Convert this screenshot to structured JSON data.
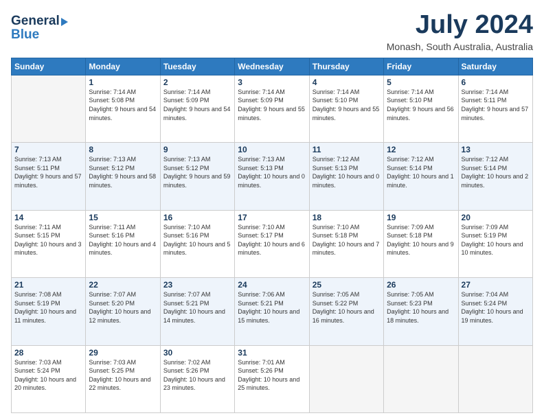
{
  "logo": {
    "line1": "General",
    "line2": "Blue"
  },
  "header": {
    "month": "July 2024",
    "location": "Monash, South Australia, Australia"
  },
  "weekdays": [
    "Sunday",
    "Monday",
    "Tuesday",
    "Wednesday",
    "Thursday",
    "Friday",
    "Saturday"
  ],
  "weeks": [
    [
      {
        "day": "",
        "sunrise": "",
        "sunset": "",
        "daylight": ""
      },
      {
        "day": "1",
        "sunrise": "Sunrise: 7:14 AM",
        "sunset": "Sunset: 5:08 PM",
        "daylight": "Daylight: 9 hours and 54 minutes."
      },
      {
        "day": "2",
        "sunrise": "Sunrise: 7:14 AM",
        "sunset": "Sunset: 5:09 PM",
        "daylight": "Daylight: 9 hours and 54 minutes."
      },
      {
        "day": "3",
        "sunrise": "Sunrise: 7:14 AM",
        "sunset": "Sunset: 5:09 PM",
        "daylight": "Daylight: 9 hours and 55 minutes."
      },
      {
        "day": "4",
        "sunrise": "Sunrise: 7:14 AM",
        "sunset": "Sunset: 5:10 PM",
        "daylight": "Daylight: 9 hours and 55 minutes."
      },
      {
        "day": "5",
        "sunrise": "Sunrise: 7:14 AM",
        "sunset": "Sunset: 5:10 PM",
        "daylight": "Daylight: 9 hours and 56 minutes."
      },
      {
        "day": "6",
        "sunrise": "Sunrise: 7:14 AM",
        "sunset": "Sunset: 5:11 PM",
        "daylight": "Daylight: 9 hours and 57 minutes."
      }
    ],
    [
      {
        "day": "7",
        "sunrise": "Sunrise: 7:13 AM",
        "sunset": "Sunset: 5:11 PM",
        "daylight": "Daylight: 9 hours and 57 minutes."
      },
      {
        "day": "8",
        "sunrise": "Sunrise: 7:13 AM",
        "sunset": "Sunset: 5:12 PM",
        "daylight": "Daylight: 9 hours and 58 minutes."
      },
      {
        "day": "9",
        "sunrise": "Sunrise: 7:13 AM",
        "sunset": "Sunset: 5:12 PM",
        "daylight": "Daylight: 9 hours and 59 minutes."
      },
      {
        "day": "10",
        "sunrise": "Sunrise: 7:13 AM",
        "sunset": "Sunset: 5:13 PM",
        "daylight": "Daylight: 10 hours and 0 minutes."
      },
      {
        "day": "11",
        "sunrise": "Sunrise: 7:12 AM",
        "sunset": "Sunset: 5:13 PM",
        "daylight": "Daylight: 10 hours and 0 minutes."
      },
      {
        "day": "12",
        "sunrise": "Sunrise: 7:12 AM",
        "sunset": "Sunset: 5:14 PM",
        "daylight": "Daylight: 10 hours and 1 minute."
      },
      {
        "day": "13",
        "sunrise": "Sunrise: 7:12 AM",
        "sunset": "Sunset: 5:14 PM",
        "daylight": "Daylight: 10 hours and 2 minutes."
      }
    ],
    [
      {
        "day": "14",
        "sunrise": "Sunrise: 7:11 AM",
        "sunset": "Sunset: 5:15 PM",
        "daylight": "Daylight: 10 hours and 3 minutes."
      },
      {
        "day": "15",
        "sunrise": "Sunrise: 7:11 AM",
        "sunset": "Sunset: 5:16 PM",
        "daylight": "Daylight: 10 hours and 4 minutes."
      },
      {
        "day": "16",
        "sunrise": "Sunrise: 7:10 AM",
        "sunset": "Sunset: 5:16 PM",
        "daylight": "Daylight: 10 hours and 5 minutes."
      },
      {
        "day": "17",
        "sunrise": "Sunrise: 7:10 AM",
        "sunset": "Sunset: 5:17 PM",
        "daylight": "Daylight: 10 hours and 6 minutes."
      },
      {
        "day": "18",
        "sunrise": "Sunrise: 7:10 AM",
        "sunset": "Sunset: 5:18 PM",
        "daylight": "Daylight: 10 hours and 7 minutes."
      },
      {
        "day": "19",
        "sunrise": "Sunrise: 7:09 AM",
        "sunset": "Sunset: 5:18 PM",
        "daylight": "Daylight: 10 hours and 9 minutes."
      },
      {
        "day": "20",
        "sunrise": "Sunrise: 7:09 AM",
        "sunset": "Sunset: 5:19 PM",
        "daylight": "Daylight: 10 hours and 10 minutes."
      }
    ],
    [
      {
        "day": "21",
        "sunrise": "Sunrise: 7:08 AM",
        "sunset": "Sunset: 5:19 PM",
        "daylight": "Daylight: 10 hours and 11 minutes."
      },
      {
        "day": "22",
        "sunrise": "Sunrise: 7:07 AM",
        "sunset": "Sunset: 5:20 PM",
        "daylight": "Daylight: 10 hours and 12 minutes."
      },
      {
        "day": "23",
        "sunrise": "Sunrise: 7:07 AM",
        "sunset": "Sunset: 5:21 PM",
        "daylight": "Daylight: 10 hours and 14 minutes."
      },
      {
        "day": "24",
        "sunrise": "Sunrise: 7:06 AM",
        "sunset": "Sunset: 5:21 PM",
        "daylight": "Daylight: 10 hours and 15 minutes."
      },
      {
        "day": "25",
        "sunrise": "Sunrise: 7:05 AM",
        "sunset": "Sunset: 5:22 PM",
        "daylight": "Daylight: 10 hours and 16 minutes."
      },
      {
        "day": "26",
        "sunrise": "Sunrise: 7:05 AM",
        "sunset": "Sunset: 5:23 PM",
        "daylight": "Daylight: 10 hours and 18 minutes."
      },
      {
        "day": "27",
        "sunrise": "Sunrise: 7:04 AM",
        "sunset": "Sunset: 5:24 PM",
        "daylight": "Daylight: 10 hours and 19 minutes."
      }
    ],
    [
      {
        "day": "28",
        "sunrise": "Sunrise: 7:03 AM",
        "sunset": "Sunset: 5:24 PM",
        "daylight": "Daylight: 10 hours and 20 minutes."
      },
      {
        "day": "29",
        "sunrise": "Sunrise: 7:03 AM",
        "sunset": "Sunset: 5:25 PM",
        "daylight": "Daylight: 10 hours and 22 minutes."
      },
      {
        "day": "30",
        "sunrise": "Sunrise: 7:02 AM",
        "sunset": "Sunset: 5:26 PM",
        "daylight": "Daylight: 10 hours and 23 minutes."
      },
      {
        "day": "31",
        "sunrise": "Sunrise: 7:01 AM",
        "sunset": "Sunset: 5:26 PM",
        "daylight": "Daylight: 10 hours and 25 minutes."
      },
      {
        "day": "",
        "sunrise": "",
        "sunset": "",
        "daylight": ""
      },
      {
        "day": "",
        "sunrise": "",
        "sunset": "",
        "daylight": ""
      },
      {
        "day": "",
        "sunrise": "",
        "sunset": "",
        "daylight": ""
      }
    ]
  ]
}
